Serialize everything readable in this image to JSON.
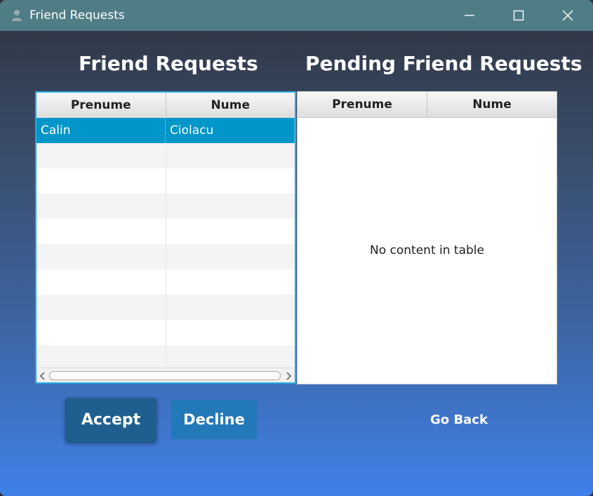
{
  "window": {
    "title": "Friend Requests"
  },
  "left": {
    "heading": "Friend Requests",
    "columns": [
      "Prenume",
      "Nume"
    ],
    "rows": [
      {
        "prenume": "Calin",
        "nume": "Ciolacu"
      }
    ]
  },
  "right": {
    "heading": "Pending Friend Requests",
    "columns": [
      "Prenume",
      "Nume"
    ],
    "empty_message": "No content in table"
  },
  "buttons": {
    "accept": "Accept",
    "decline": "Decline",
    "go_back": "Go Back"
  },
  "colors": {
    "selection": "#0096c9",
    "accept_bg": "#1f5f8f",
    "decline_bg": "#2379b8",
    "titlebar": "#4f7d85"
  }
}
